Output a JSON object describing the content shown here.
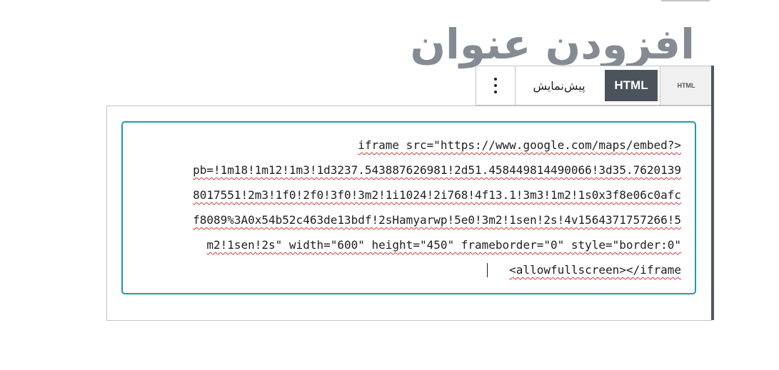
{
  "title": "افزودن عنوان",
  "toolbar": {
    "preview_label": "پیش‌نمایش",
    "html_label": "HTML",
    "block_type_label": "HTML"
  },
  "code": {
    "lines": [
      "iframe src=\"https://www.google.com/maps/embed?>",
      "pb=!1m18!1m12!1m3!1d3237.543887626981!2d51.458449814490066!3d35.7620139",
      "8017551!2m3!1f0!2f0!3f0!3m2!1i1024!2i768!4f13.1!3m3!1m2!1s0x3f8e06c0afc",
      "f8089%3A0x54b52c463de13bdf!2sHamyarwp!5e0!3m2!1sen!2s!4v1564371757266!5",
      "m2!1sen!2s\" width=\"600\" height=\"450\" frameborder=\"0\" style=\"border:0\"",
      "<allowfullscreen></iframe"
    ]
  },
  "colors": {
    "accent": "#1d9ca3",
    "title": "#848b93",
    "html_tab_bg": "#4b535b"
  }
}
